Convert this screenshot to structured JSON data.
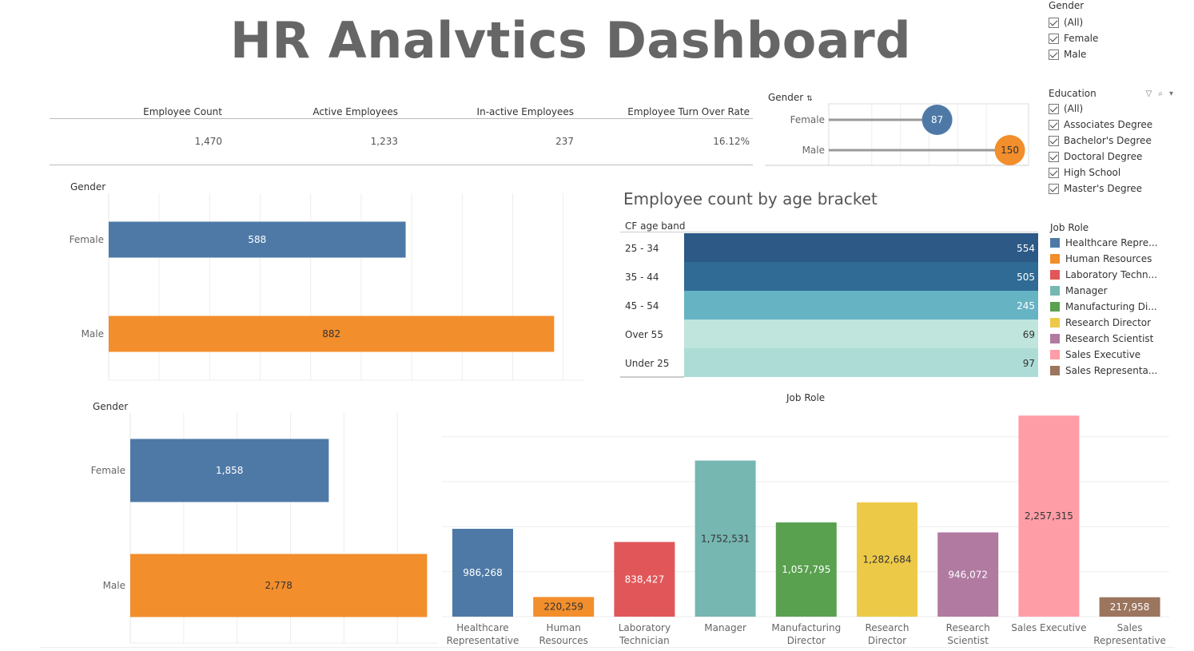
{
  "title": "HR Analvtics Dashboard",
  "kpis": {
    "headers": [
      "Employee Count",
      "Active Employees",
      "In-active Employees",
      "Employee Turn Over Rate"
    ],
    "values": [
      "1,470",
      "1,233",
      "237",
      "16.12%"
    ]
  },
  "filters": {
    "gender": {
      "title": "Gender",
      "items": [
        "(All)",
        "Female",
        "Male"
      ]
    },
    "education": {
      "title": "Education",
      "items": [
        "(All)",
        "Associates Degree",
        "Bachelor's Degree",
        "Doctoral Degree",
        "High School",
        "Master's Degree"
      ]
    }
  },
  "job_role_legend": {
    "title": "Job Role",
    "items": [
      {
        "label": "Healthcare Repre...",
        "color": "#4e79a7"
      },
      {
        "label": "Human Resources",
        "color": "#f28e2b"
      },
      {
        "label": "Laboratory Techn...",
        "color": "#e15759"
      },
      {
        "label": "Manager",
        "color": "#76b7b2"
      },
      {
        "label": "Manufacturing Di...",
        "color": "#59a14f"
      },
      {
        "label": "Research Director",
        "color": "#edc948"
      },
      {
        "label": "Research Scientist",
        "color": "#b07aa1"
      },
      {
        "label": "Sales Executive",
        "color": "#ff9da7"
      },
      {
        "label": "Sales Representa...",
        "color": "#9c755f"
      }
    ]
  },
  "chart_data": [
    {
      "id": "gender_dots",
      "type": "scatter",
      "xlabel": "Gender",
      "categories": [
        "Female",
        "Male"
      ],
      "values": [
        87,
        150
      ],
      "colors": [
        "#4e79a7",
        "#f28e2b"
      ]
    },
    {
      "id": "gender_count",
      "type": "bar",
      "orientation": "horizontal",
      "xlabel": "Gender",
      "categories": [
        "Female",
        "Male"
      ],
      "values": [
        588,
        882
      ],
      "value_labels": [
        "588",
        "882"
      ],
      "colors": [
        "#4e79a7",
        "#f28e2b"
      ]
    },
    {
      "id": "age_bracket",
      "type": "bar",
      "orientation": "horizontal",
      "title": "Employee count by age bracket",
      "xlabel": "CF age band",
      "categories": [
        "25 - 34",
        "35 - 44",
        "45 - 54",
        "Over 55",
        "Under 25"
      ],
      "values": [
        554,
        505,
        245,
        69,
        97
      ],
      "colors": [
        "#2c5985",
        "#2f6b94",
        "#66b3c4",
        "#bfe5dc",
        "#addcd6"
      ]
    },
    {
      "id": "gender_second",
      "type": "bar",
      "orientation": "horizontal",
      "xlabel": "Gender",
      "categories": [
        "Female",
        "Male"
      ],
      "values": [
        1858,
        2778
      ],
      "value_labels": [
        "1,858",
        "2,778"
      ],
      "colors": [
        "#4e79a7",
        "#f28e2b"
      ]
    },
    {
      "id": "job_role",
      "type": "bar",
      "title": "Job Role",
      "categories": [
        "Healthcare\nRepresentative",
        "Human\nResources",
        "Laboratory\nTechnician",
        "Manager",
        "Manufacturing\nDirector",
        "Research\nDirector",
        "Research\nScientist",
        "Sales Executive",
        "Sales\nRepresentative"
      ],
      "values": [
        986268,
        220259,
        838427,
        1752531,
        1057795,
        1282684,
        946072,
        2257315,
        217958
      ],
      "value_labels": [
        "986,268",
        "220,259",
        "838,427",
        "1,752,531",
        "1,057,795",
        "1,282,684",
        "946,072",
        "2,257,315",
        "217,958"
      ],
      "colors": [
        "#4e79a7",
        "#f28e2b",
        "#e15759",
        "#76b7b2",
        "#59a14f",
        "#edc948",
        "#b07aa1",
        "#ff9da7",
        "#9c755f"
      ]
    }
  ]
}
